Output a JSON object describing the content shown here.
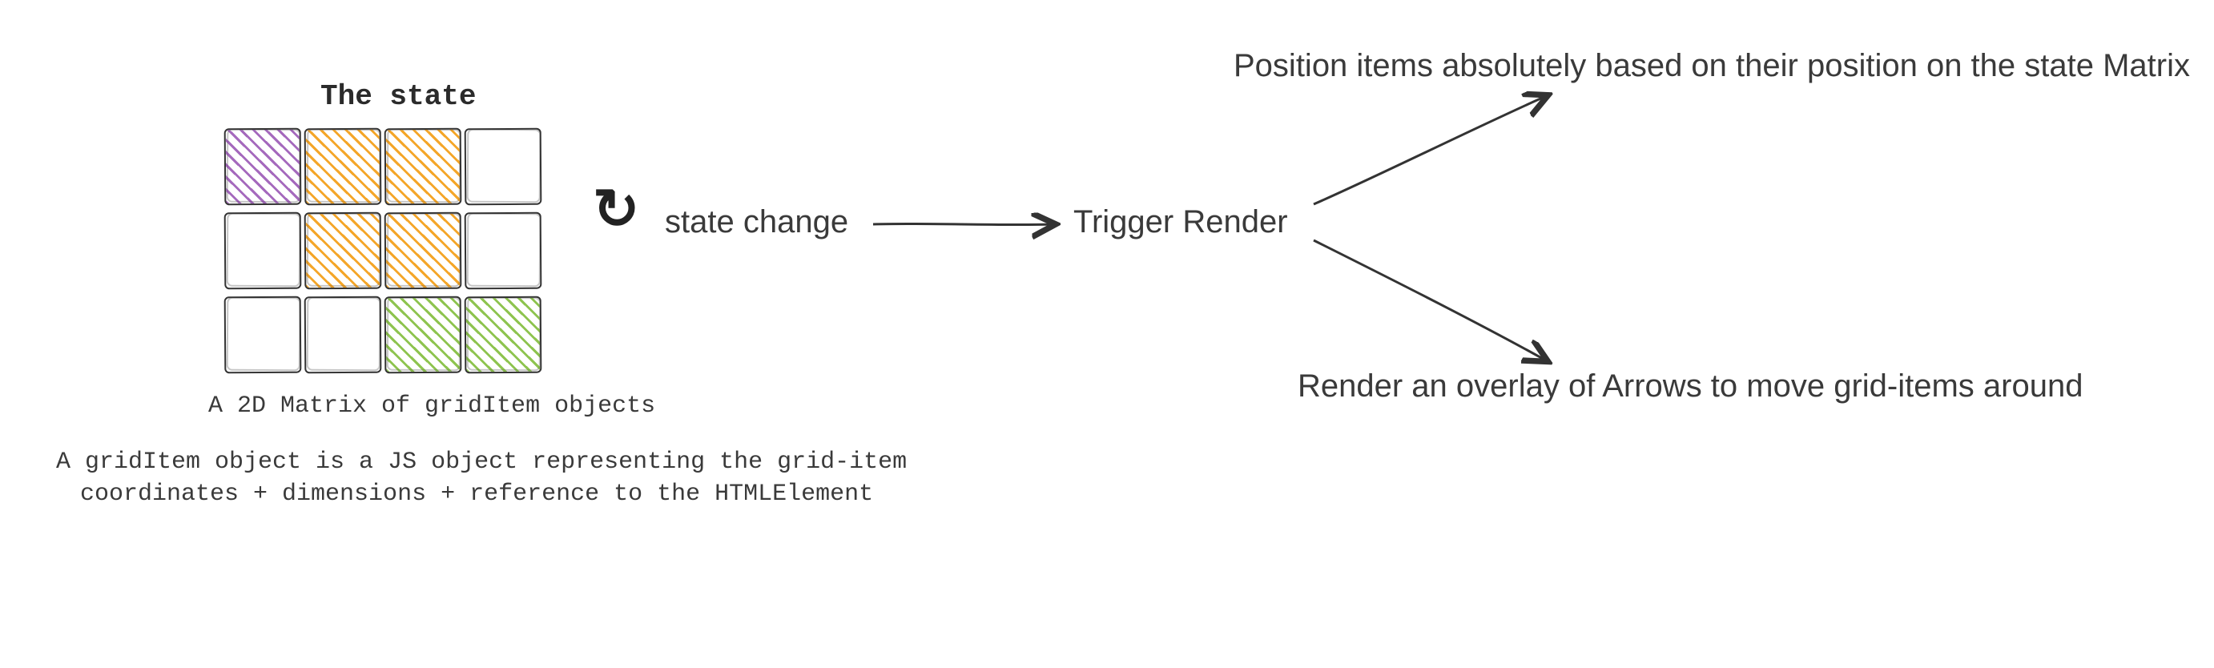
{
  "title": "The state",
  "grid_caption": "A 2D Matrix of gridItem objects",
  "grid_note_line1": "A gridItem object is a JS object representing the grid-item",
  "grid_note_line2": "coordinates + dimensions + reference to the HTMLElement",
  "flow": {
    "state_change": "state change",
    "trigger_render": "Trigger Render"
  },
  "branches": {
    "top": "Position items absolutely based on their position on the state Matrix",
    "bottom": "Render an overlay of Arrows to move grid-items around"
  },
  "colors": {
    "purple": "#9b59b6",
    "orange": "#f39c12",
    "green": "#82be3c",
    "ink": "#333333"
  },
  "grid": {
    "rows": 3,
    "cols": 4,
    "cells": [
      {
        "r": 0,
        "c": 0,
        "fill": "purple"
      },
      {
        "r": 0,
        "c": 1,
        "fill": "orange"
      },
      {
        "r": 0,
        "c": 2,
        "fill": "orange"
      },
      {
        "r": 0,
        "c": 3,
        "fill": "none"
      },
      {
        "r": 1,
        "c": 0,
        "fill": "none"
      },
      {
        "r": 1,
        "c": 1,
        "fill": "orange"
      },
      {
        "r": 1,
        "c": 2,
        "fill": "orange"
      },
      {
        "r": 1,
        "c": 3,
        "fill": "none"
      },
      {
        "r": 2,
        "c": 0,
        "fill": "none"
      },
      {
        "r": 2,
        "c": 1,
        "fill": "none"
      },
      {
        "r": 2,
        "c": 2,
        "fill": "green"
      },
      {
        "r": 2,
        "c": 3,
        "fill": "green"
      }
    ]
  }
}
